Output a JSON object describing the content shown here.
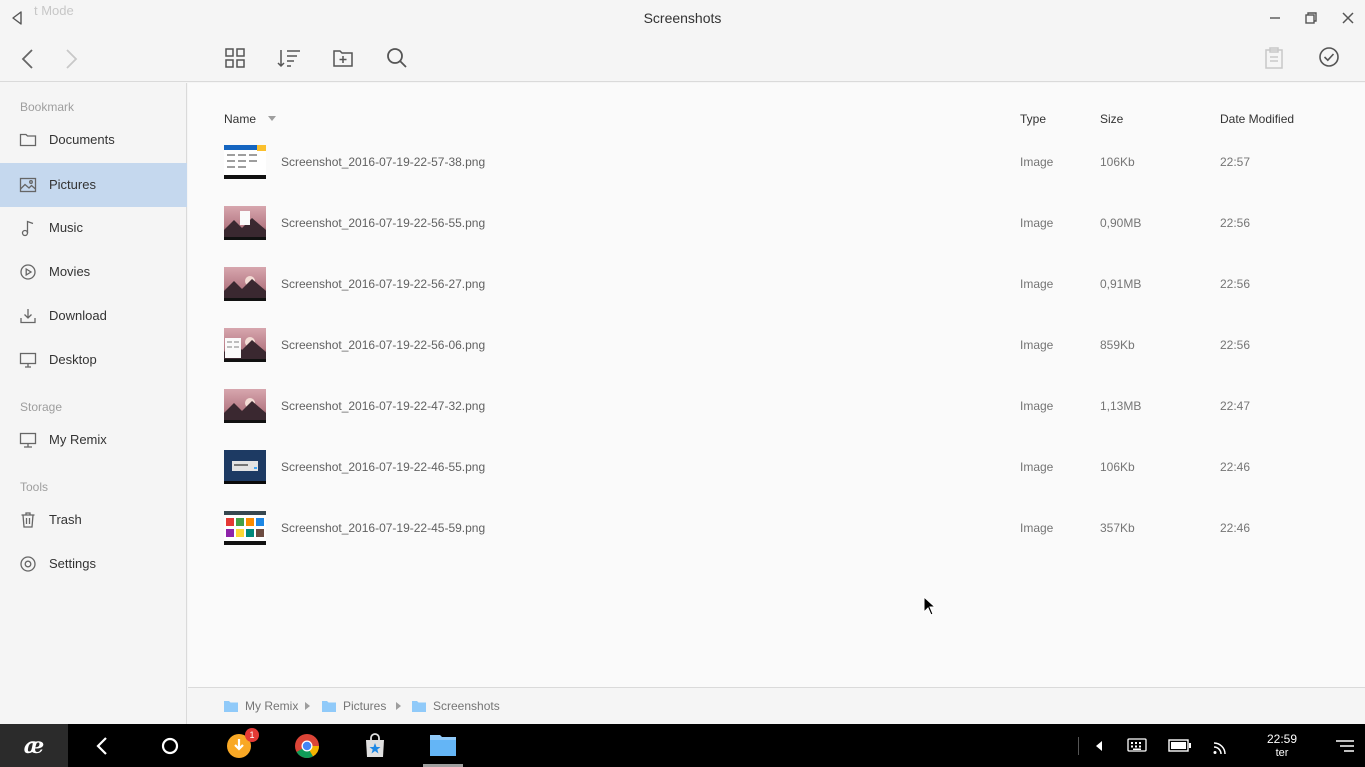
{
  "window": {
    "title": "Screenshots",
    "ghost_text": "t Mode"
  },
  "sidebar": {
    "sections": [
      {
        "label": "Bookmark",
        "items": [
          {
            "label": "Documents",
            "icon": "folder-icon"
          },
          {
            "label": "Pictures",
            "icon": "picture-icon",
            "active": true
          },
          {
            "label": "Music",
            "icon": "music-icon"
          },
          {
            "label": "Movies",
            "icon": "movie-icon"
          },
          {
            "label": "Download",
            "icon": "download-icon"
          },
          {
            "label": "Desktop",
            "icon": "desktop-icon"
          }
        ]
      },
      {
        "label": "Storage",
        "items": [
          {
            "label": "My Remix",
            "icon": "computer-icon"
          }
        ]
      },
      {
        "label": "Tools",
        "items": [
          {
            "label": "Trash",
            "icon": "trash-icon"
          },
          {
            "label": "Settings",
            "icon": "settings-icon"
          }
        ]
      }
    ]
  },
  "columns": {
    "name": "Name",
    "type": "Type",
    "size": "Size",
    "date": "Date Modified"
  },
  "files": [
    {
      "name": "Screenshot_2016-07-19-22-57-38.png",
      "type": "Image",
      "size": "106Kb",
      "date": "22:57",
      "thumb": "white"
    },
    {
      "name": "Screenshot_2016-07-19-22-56-55.png",
      "type": "Image",
      "size": "0,90MB",
      "date": "22:56",
      "thumb": "sunset-dialog"
    },
    {
      "name": "Screenshot_2016-07-19-22-56-27.png",
      "type": "Image",
      "size": "0,91MB",
      "date": "22:56",
      "thumb": "sunset"
    },
    {
      "name": "Screenshot_2016-07-19-22-56-06.png",
      "type": "Image",
      "size": "859Kb",
      "date": "22:56",
      "thumb": "sunset-window"
    },
    {
      "name": "Screenshot_2016-07-19-22-47-32.png",
      "type": "Image",
      "size": "1,13MB",
      "date": "22:47",
      "thumb": "sunset"
    },
    {
      "name": "Screenshot_2016-07-19-22-46-55.png",
      "type": "Image",
      "size": "106Kb",
      "date": "22:46",
      "thumb": "blue"
    },
    {
      "name": "Screenshot_2016-07-19-22-45-59.png",
      "type": "Image",
      "size": "357Kb",
      "date": "22:46",
      "thumb": "grid"
    }
  ],
  "breadcrumb": [
    "My Remix",
    "Pictures",
    "Screenshots"
  ],
  "taskbar": {
    "time": "22:59",
    "day": "ter",
    "download_badge": "1"
  },
  "colors": {
    "selection": "#c5d8ee",
    "folder_blue": "#90caf9",
    "taskbar": "#000000",
    "badge": "#e53935",
    "download_app": "#f9a825"
  }
}
